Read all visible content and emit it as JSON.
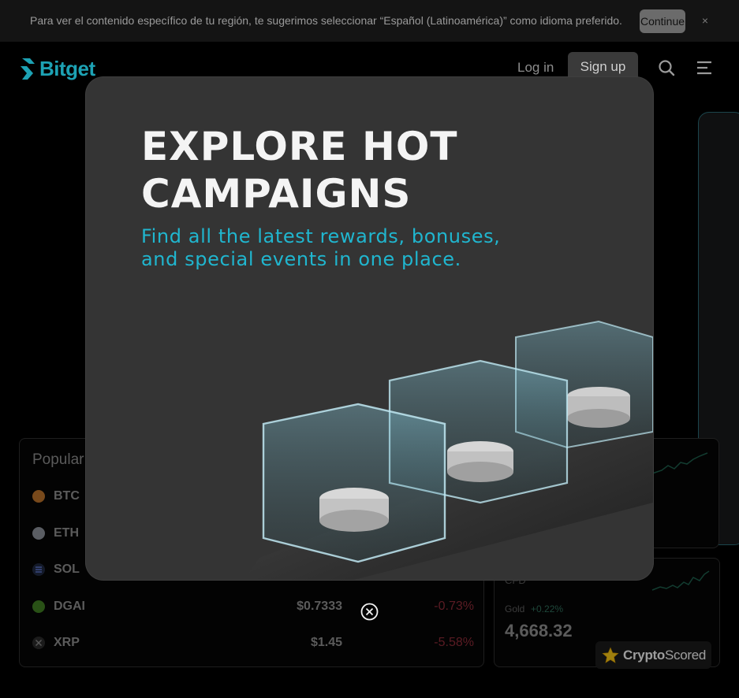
{
  "banner": {
    "text": "Para ver el contenido específico de tu región, te sugerimos seleccionar “Español (Latinoamérica)” como idioma preferido.",
    "continue_label": "Continue",
    "close_glyph": "×"
  },
  "header": {
    "logo_text": "Bitget",
    "login_label": "Log in",
    "signup_label": "Sign up",
    "search_icon": "search-icon",
    "menu_icon": "menu-icon"
  },
  "markets": {
    "title": "Popular",
    "rows": [
      {
        "symbol": "BTC",
        "price": "",
        "change": "",
        "color": "#b8702a"
      },
      {
        "symbol": "ETH",
        "price": "",
        "change": "",
        "color": "#8a8f99"
      },
      {
        "symbol": "SOL",
        "price": "",
        "change": "",
        "color": "#3a4d8f"
      },
      {
        "symbol": "DGAI",
        "price": "$0.7333",
        "change": "-0.73%",
        "color": "#3f7d23"
      },
      {
        "symbol": "XRP",
        "price": "$1.45",
        "change": "-5.58%",
        "color": "#3b3b3b"
      }
    ]
  },
  "cfd": {
    "label": "CFD",
    "asset": "Gold",
    "change": "+0.22%",
    "price": "4,668.32"
  },
  "badge": {
    "brand_bold": "Crypto",
    "brand_light": "Scored"
  },
  "modal": {
    "title": "EXPLORE HOT CAMPAIGNS",
    "subtitle": "Find all the latest rewards, bonuses, and special events in one place.",
    "close_icon": "close-circle-icon"
  },
  "colors": {
    "brand": "#1da2b4",
    "accent_cyan": "#20b6cf",
    "negative": "#8a2a36",
    "positive": "#2f6e5a"
  }
}
